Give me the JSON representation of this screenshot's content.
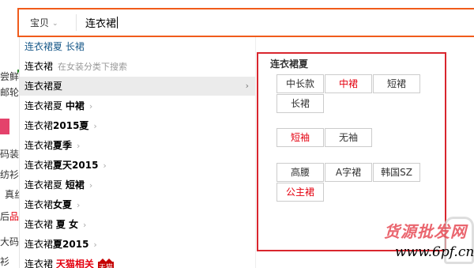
{
  "background": {
    "fragments": [
      "尝鲜",
      "邮轮",
      "码装",
      "纺衫",
      "真丝",
      "品",
      "大码",
      "衫"
    ],
    "left_prefix": "后"
  },
  "search": {
    "scope_label": "宝贝",
    "query": "连衣裙"
  },
  "suggestions": [
    {
      "parts": [
        {
          "text": "连衣裙夏 长裙",
          "style": "blue"
        }
      ],
      "arrow": false
    },
    {
      "parts": [
        {
          "text": "连衣裙",
          "style": ""
        }
      ],
      "hint": "在女装分类下搜索",
      "arrow": false
    },
    {
      "parts": [
        {
          "text": "连衣裙夏",
          "style": ""
        }
      ],
      "arrow": true,
      "active": true
    },
    {
      "parts": [
        {
          "text": "连衣裙夏 ",
          "style": ""
        },
        {
          "text": "中裙",
          "style": "bold"
        }
      ],
      "arrow": true
    },
    {
      "parts": [
        {
          "text": "连衣裙",
          "style": ""
        },
        {
          "text": "2015夏",
          "style": "bold"
        }
      ],
      "arrow": true
    },
    {
      "parts": [
        {
          "text": "连衣裙",
          "style": ""
        },
        {
          "text": "夏季",
          "style": "bold"
        }
      ],
      "arrow": true
    },
    {
      "parts": [
        {
          "text": "连衣裙",
          "style": ""
        },
        {
          "text": "夏天2015",
          "style": "bold"
        }
      ],
      "arrow": true
    },
    {
      "parts": [
        {
          "text": "连衣裙夏 ",
          "style": ""
        },
        {
          "text": "短裙",
          "style": "bold"
        }
      ],
      "arrow": true
    },
    {
      "parts": [
        {
          "text": "连衣裙",
          "style": ""
        },
        {
          "text": "女夏",
          "style": "bold"
        }
      ],
      "arrow": true
    },
    {
      "parts": [
        {
          "text": "连衣裙 ",
          "style": ""
        },
        {
          "text": "夏 女",
          "style": "bold"
        }
      ],
      "arrow": true
    },
    {
      "parts": [
        {
          "text": "连衣裙",
          "style": ""
        },
        {
          "text": "夏2015",
          "style": "bold"
        }
      ],
      "arrow": true
    },
    {
      "parts": [
        {
          "text": "连衣裙 ",
          "style": ""
        },
        {
          "text": "天猫相关",
          "style": "red"
        }
      ],
      "arrow": false,
      "tmall": true
    }
  ],
  "tmall_badge": "天猫",
  "attribute_panel": {
    "title": "连衣裙夏",
    "groups": [
      [
        "中长款",
        "中裙",
        "短裙",
        "长裙"
      ],
      [
        "短袖",
        "无袖"
      ],
      [
        "高腰",
        "A字裙",
        "韩国SZ",
        "公主裙"
      ]
    ],
    "highlighted": [
      "中裙",
      "短袖",
      "公主裙"
    ],
    "accent_color": "#e4000f",
    "border_color": "#d9262e"
  },
  "watermark": {
    "text": "货源批发网",
    "url": "www.6pf.cn"
  }
}
